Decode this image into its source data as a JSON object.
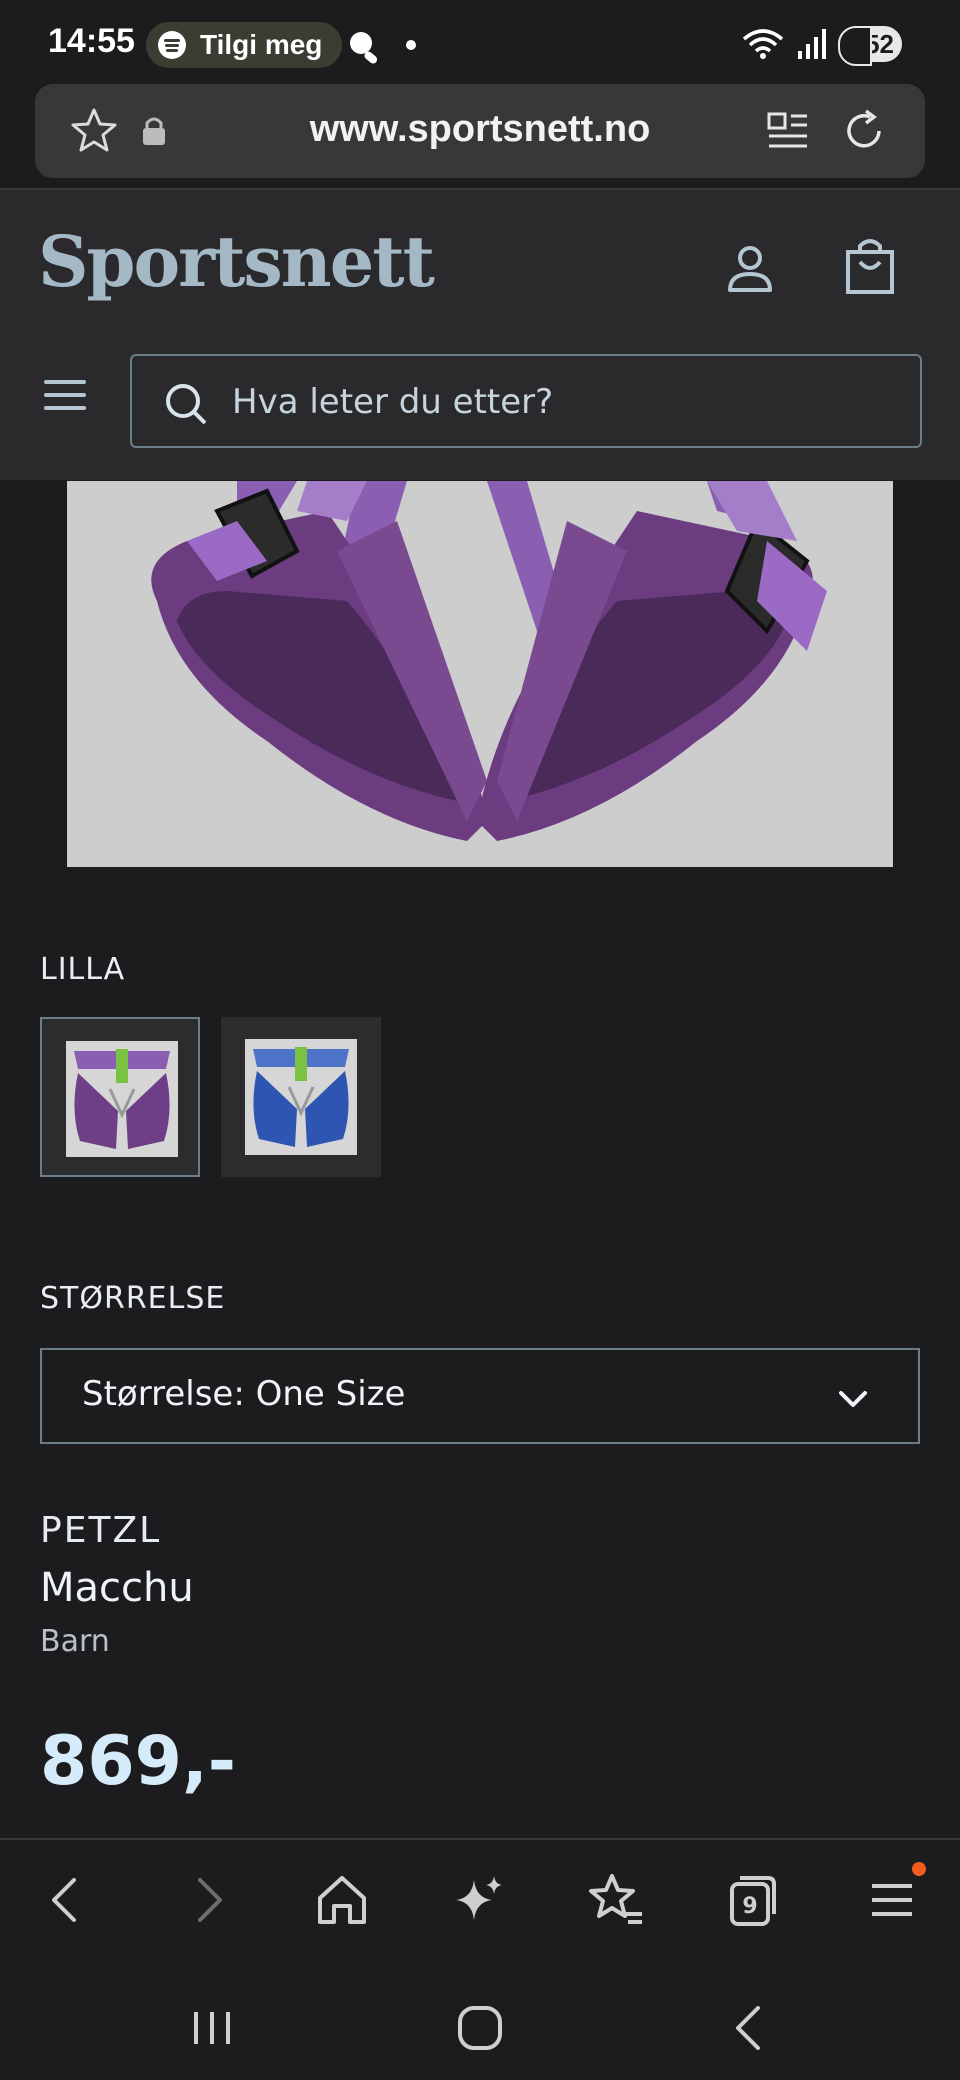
{
  "status_bar": {
    "time": "14:55",
    "now_playing": "Tilgi meg",
    "battery": "52"
  },
  "browser": {
    "url": "www.sportsnett.no",
    "tabs_count": "9"
  },
  "site": {
    "logo": "Sportsnett",
    "search_placeholder": "Hva leter du etter?"
  },
  "product": {
    "color_label": "LILLA",
    "swatches": [
      {
        "color_name": "purple",
        "hex": "#6e3f86"
      },
      {
        "color_name": "blue",
        "hex": "#2f55b3"
      }
    ],
    "size_section_label": "STØRRELSE",
    "size_select_value": "Størrelse: One Size",
    "brand": "PETZL",
    "name": "Macchu",
    "category": "Barn",
    "price": "869,-"
  },
  "colors": {
    "accent": "#a5b8c6",
    "price": "#d6ebf9",
    "notification_dot": "#f25c1e"
  }
}
